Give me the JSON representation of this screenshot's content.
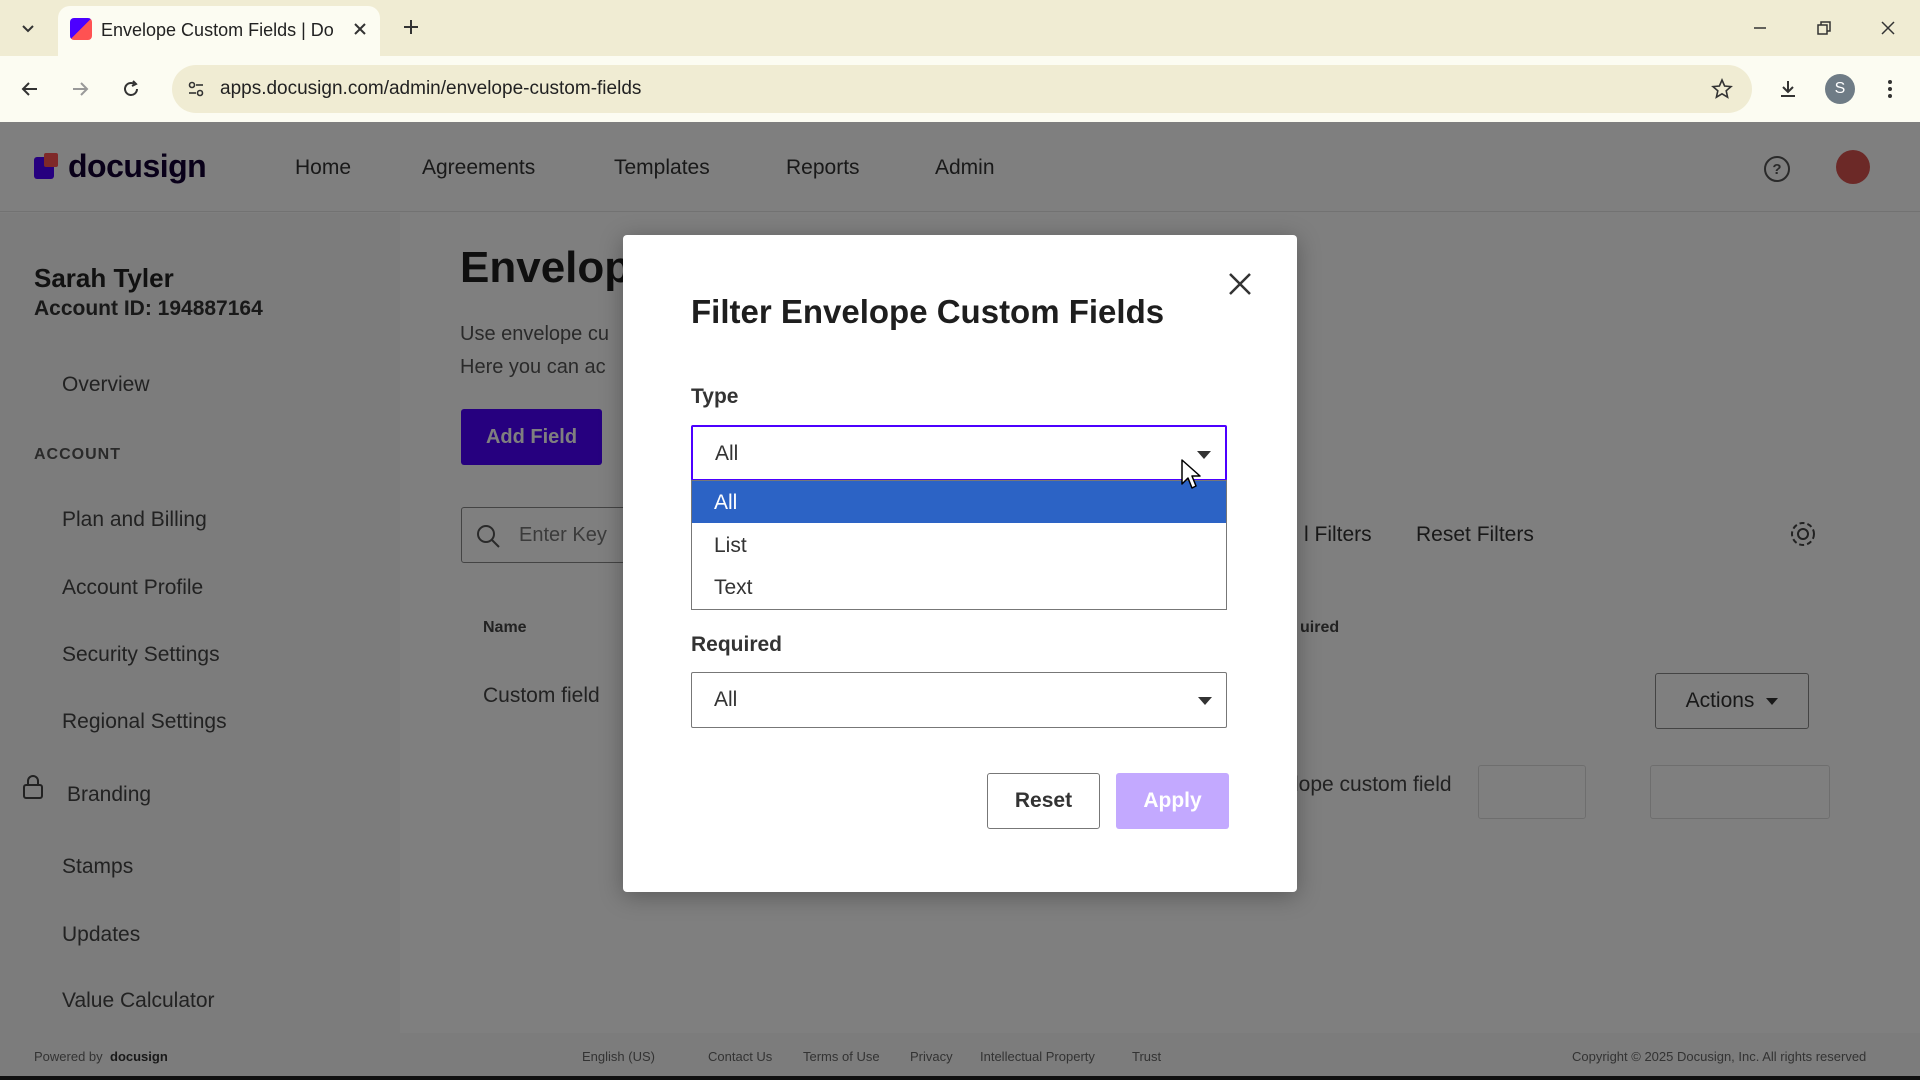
{
  "browser": {
    "tab_title": "Envelope Custom Fields | Docusign",
    "url": "apps.docusign.com/admin/envelope-custom-fields",
    "profile_initial": "S"
  },
  "app": {
    "logo_text": "docusign",
    "nav": [
      "Home",
      "Agreements",
      "Templates",
      "Reports",
      "Admin"
    ],
    "help_label": "?"
  },
  "sidebar": {
    "user_name": "Sarah Tyler",
    "account_id": "Account ID: 194887164",
    "overview": "Overview",
    "account_heading": "ACCOUNT",
    "items": [
      "Plan and Billing",
      "Account Profile",
      "Security Settings",
      "Regional Settings",
      "Branding",
      "Stamps",
      "Updates",
      "Value Calculator"
    ]
  },
  "main": {
    "page_title": "Envelop",
    "desc_line1": "Use envelope cu",
    "desc_line2": "Here you can ac",
    "add_button": "Add Field",
    "search_placeholder": "Enter Key",
    "filters_link": "l Filters",
    "reset_filters_link": "Reset Filters",
    "col_name": "Name",
    "col_required": "uired",
    "row1_name": "Custom field",
    "row1_required": "",
    "row2_partial": "lope custom field",
    "actions_button": "Actions"
  },
  "footer": {
    "powered_by": "Powered by",
    "powered_brand": "docusign",
    "language": "English (US)",
    "links": [
      "Contact Us",
      "Terms of Use",
      "Privacy",
      "Intellectual Property",
      "Trust"
    ],
    "copyright": "Copyright © 2025 Docusign, Inc. All rights reserved"
  },
  "modal": {
    "title": "Filter Envelope Custom Fields",
    "type_label": "Type",
    "type_value": "All",
    "type_options": [
      "All",
      "List",
      "Text"
    ],
    "required_label": "Required",
    "required_value": "All",
    "reset_button": "Reset",
    "apply_button": "Apply"
  },
  "colors": {
    "brand_purple": "#4c00ff",
    "selected_option": "#2c63c5",
    "apply_disabled": "#c3a9ff",
    "chrome_bg": "#f0ecd3"
  }
}
